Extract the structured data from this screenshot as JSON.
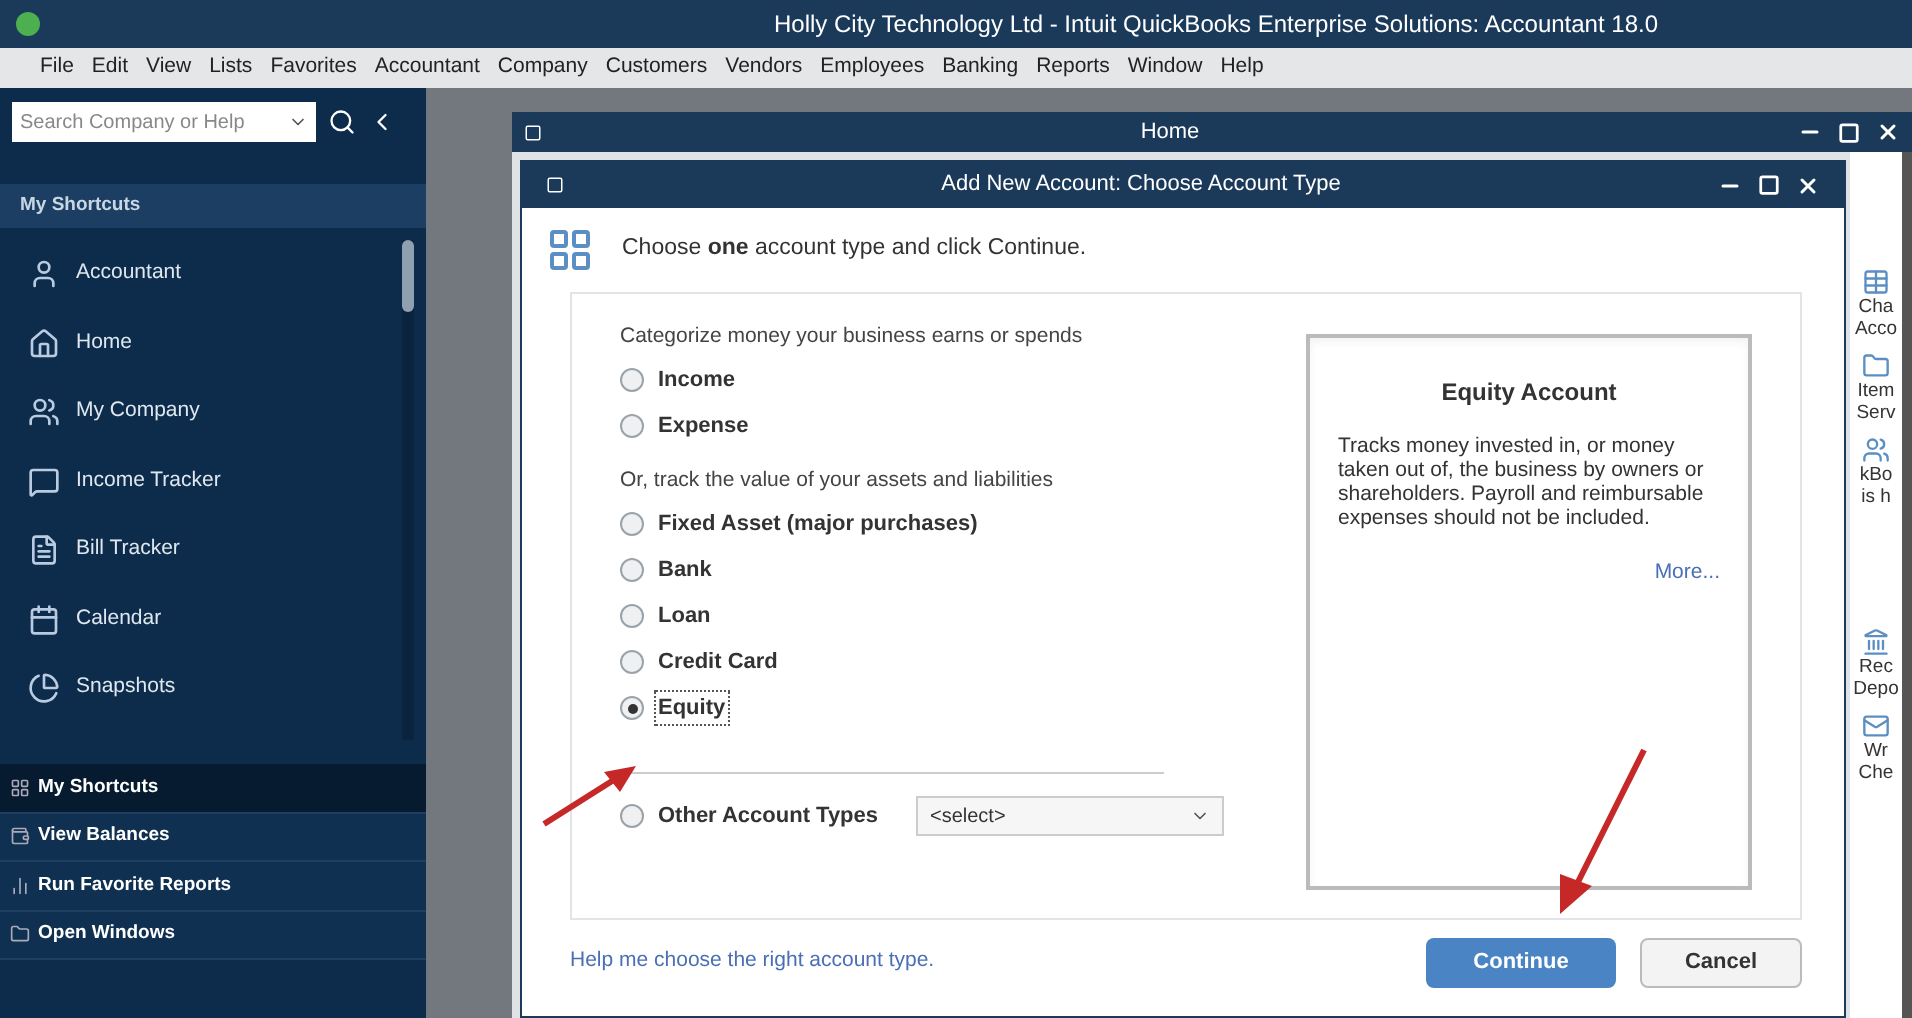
{
  "window": {
    "title": "Holly City Technology Ltd  - Intuit QuickBooks Enterprise Solutions: Accountant 18.0"
  },
  "menu": [
    "File",
    "Edit",
    "View",
    "Lists",
    "Favorites",
    "Accountant",
    "Company",
    "Customers",
    "Vendors",
    "Employees",
    "Banking",
    "Reports",
    "Window",
    "Help"
  ],
  "search": {
    "placeholder": "Search Company or Help"
  },
  "sidebar": {
    "header": "My Shortcuts",
    "items": [
      {
        "label": "Accountant"
      },
      {
        "label": "Home"
      },
      {
        "label": "My Company"
      },
      {
        "label": "Income Tracker"
      },
      {
        "label": "Bill Tracker"
      },
      {
        "label": "Calendar"
      },
      {
        "label": "Snapshots"
      }
    ],
    "sections": [
      {
        "label": "My Shortcuts",
        "selected": true
      },
      {
        "label": "View Balances",
        "selected": false
      },
      {
        "label": "Run Favorite Reports",
        "selected": false
      },
      {
        "label": "Open Windows",
        "selected": false
      }
    ]
  },
  "home": {
    "title": "Home",
    "side_items": [
      {
        "lines": [
          "Cha",
          "Acco"
        ]
      },
      {
        "lines": [
          "Item",
          "Serv"
        ]
      },
      {
        "lines": [
          "kBo",
          "is h"
        ]
      },
      {
        "lines": [
          "Rec",
          "Depo"
        ]
      },
      {
        "lines": [
          "Wr",
          "Che"
        ]
      }
    ]
  },
  "dialog": {
    "title": "Add New Account: Choose Account Type",
    "instruction": "Choose **one** account type and click Continue.",
    "groups": [
      {
        "caption": "Categorize money your business earns or spends",
        "options": [
          {
            "label": "Income",
            "selected": false
          },
          {
            "label": "Expense",
            "selected": false
          }
        ]
      },
      {
        "caption": "Or, track the value of your assets and liabilities",
        "options": [
          {
            "label": "Fixed Asset (major purchases)",
            "selected": false
          },
          {
            "label": "Bank",
            "selected": false
          },
          {
            "label": "Loan",
            "selected": false
          },
          {
            "label": "Credit Card",
            "selected": false
          },
          {
            "label": "Equity",
            "selected": true
          }
        ]
      }
    ],
    "other": {
      "label": "Other Account Types",
      "selected": false,
      "select_value": "<select>"
    },
    "description": {
      "title": "Equity Account",
      "text": "Tracks money invested in, or money taken out of, the business by owners or shareholders. Payroll and reimbursable expenses should not be included.",
      "link": "More..."
    },
    "help_link": "Help me choose the right account type.",
    "buttons": [
      {
        "label": "Continue",
        "kind": "primary"
      },
      {
        "label": "Cancel",
        "kind": "secondary"
      }
    ]
  }
}
